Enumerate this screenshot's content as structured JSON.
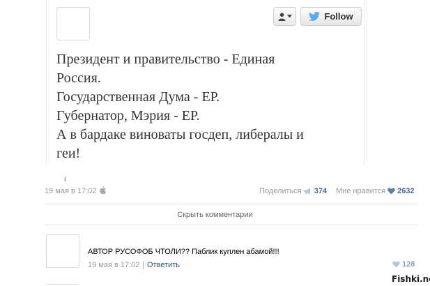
{
  "tweet": {
    "follow_label": "Follow",
    "lines": [
      "Президент и правительство - Единая",
      "Россия.",
      "Государственная Дума - ЕР.",
      "Губернатор, Мэрия - ЕР.",
      "А в бардаке виноваты госдеп, либералы и",
      "геи!"
    ]
  },
  "post_meta": {
    "link_text": "I",
    "date": "19 мая в 17:02",
    "share_label": "Поделиться",
    "share_count": "374",
    "like_label": "Мне нравится",
    "like_count": "2632"
  },
  "hide_comments_label": "Скрыть комментарии",
  "comment": {
    "text": "АВТОР РУСОФОБ ЧТОЛИ?? Паблик куплен абамой!!!",
    "date": "19 мая в 17:02",
    "separator": "|",
    "reply_label": "Ответить",
    "like_count": "128"
  },
  "watermark": "Fishki.net",
  "colors": {
    "link": "#2b587a",
    "count": "#45688e",
    "twitter_bird": "#55acee"
  },
  "icons": {
    "user": "user-icon",
    "caret": "caret-down-icon",
    "twitter": "twitter-bird-icon",
    "share": "megaphone-icon",
    "heart": "heart-icon",
    "apple": "apple-icon"
  }
}
